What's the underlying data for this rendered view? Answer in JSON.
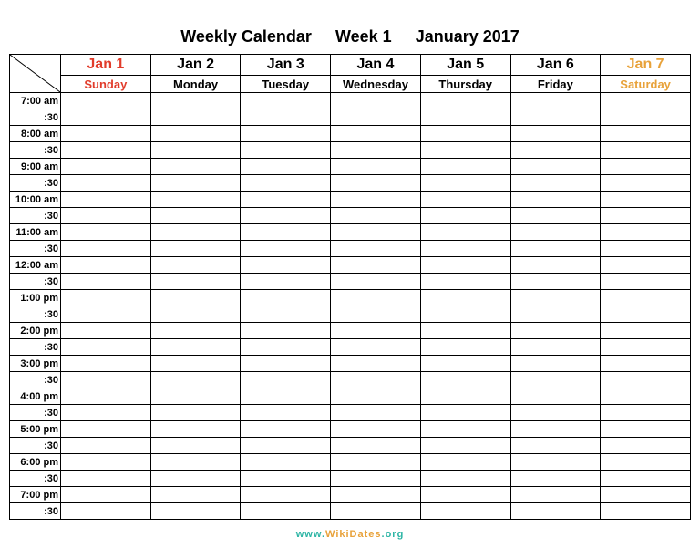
{
  "title": {
    "main": "Weekly Calendar",
    "week": "Week 1",
    "monthYear": "January 2017"
  },
  "days": [
    {
      "date": "Jan 1",
      "name": "Sunday",
      "style": "sunday"
    },
    {
      "date": "Jan 2",
      "name": "Monday",
      "style": "weekday"
    },
    {
      "date": "Jan 3",
      "name": "Tuesday",
      "style": "weekday"
    },
    {
      "date": "Jan 4",
      "name": "Wednesday",
      "style": "weekday"
    },
    {
      "date": "Jan 5",
      "name": "Thursday",
      "style": "weekday"
    },
    {
      "date": "Jan 6",
      "name": "Friday",
      "style": "weekday"
    },
    {
      "date": "Jan 7",
      "name": "Saturday",
      "style": "saturday"
    }
  ],
  "timeSlots": [
    "7:00 am",
    ":30",
    "8:00 am",
    ":30",
    "9:00 am",
    ":30",
    "10:00 am",
    ":30",
    "11:00 am",
    ":30",
    "12:00 am",
    ":30",
    "1:00 pm",
    ":30",
    "2:00 pm",
    ":30",
    "3:00 pm",
    ":30",
    "4:00 pm",
    ":30",
    "5:00 pm",
    ":30",
    "6:00 pm",
    ":30",
    "7:00 pm",
    ":30"
  ],
  "footer": {
    "prefix": "www.",
    "brand": "WikiDates",
    "suffix": ".org"
  }
}
